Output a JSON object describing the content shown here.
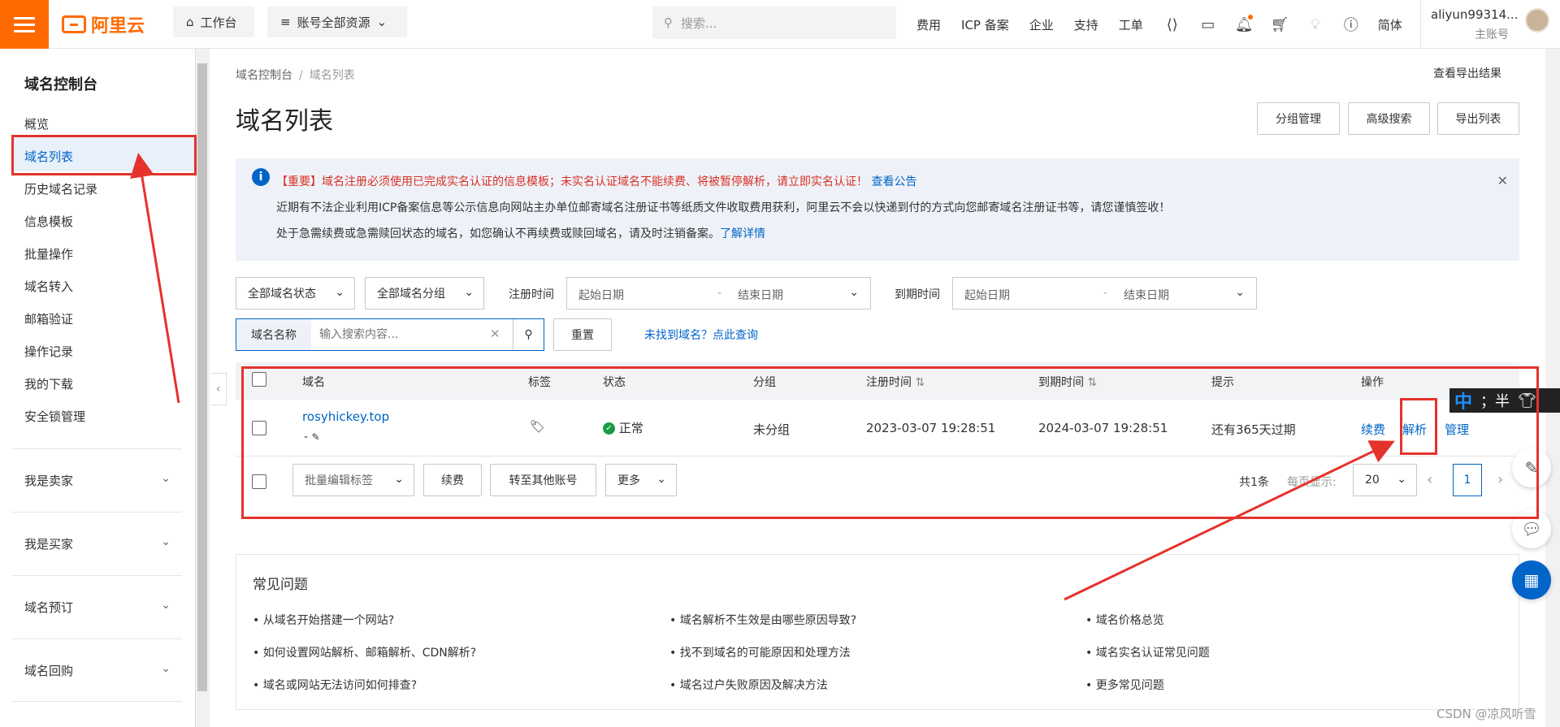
{
  "topbar": {
    "logo_text": "阿里云",
    "workbench": "工作台",
    "resources": "账号全部资源",
    "search_placeholder": "搜索...",
    "nav": [
      "费用",
      "ICP 备案",
      "企业",
      "支持",
      "工单"
    ],
    "lang": "简体",
    "user_name": "aliyun99314...",
    "user_role": "主账号"
  },
  "sidebar": {
    "title": "域名控制台",
    "items": [
      "概览",
      "域名列表",
      "历史域名记录",
      "信息模板",
      "批量操作",
      "域名转入",
      "邮箱验证",
      "操作记录",
      "我的下载",
      "安全锁管理"
    ],
    "groups": [
      "我是卖家",
      "我是买家",
      "域名预订",
      "域名回购"
    ]
  },
  "breadcrumb": {
    "root": "域名控制台",
    "current": "域名列表"
  },
  "export_result": "查看导出结果",
  "page_title": "域名列表",
  "actions": {
    "group": "分组管理",
    "advanced": "高级搜索",
    "export": "导出列表"
  },
  "notice": {
    "line1": "【重要】域名注册必须使用已完成实名认证的信息模板；未实名认证域名不能续费、将被暂停解析，请立即实名认证！",
    "line1_link": "查看公告",
    "line2": "近期有不法企业利用ICP备案信息等公示信息向网站主办单位邮寄域名注册证书等纸质文件收取费用获利，阿里云不会以快递到付的方式向您邮寄域名注册证书等，请您谨慎签收！",
    "line3": "处于急需续费或急需赎回状态的域名，如您确认不再续费或赎回域名，请及时注销备案。",
    "line3_link": "了解详情"
  },
  "filters": {
    "status": "全部域名状态",
    "group": "全部域名分组",
    "reg_label": "注册时间",
    "exp_label": "到期时间",
    "start": "起始日期",
    "end": "结束日期",
    "name_label": "域名名称",
    "search_placeholder": "输入搜索内容...",
    "reset": "重置",
    "not_found": "未找到域名？点此查询"
  },
  "table": {
    "headers": {
      "domain": "域名",
      "tag": "标签",
      "status": "状态",
      "group": "分组",
      "reg": "注册时间",
      "exp": "到期时间",
      "hint": "提示",
      "ops": "操作"
    },
    "rows": [
      {
        "domain": "rosyhickey.top",
        "sub": "-",
        "status": "正常",
        "group": "未分组",
        "reg": "2023-03-07 19:28:51",
        "exp": "2024-03-07 19:28:51",
        "hint": "还有365天过期",
        "op_renew": "续费",
        "op_dns": "解析",
        "op_manage": "管理"
      }
    ]
  },
  "bulk": {
    "edit_tags": "批量编辑标签",
    "renew": "续费",
    "transfer": "转至其他账号",
    "more": "更多",
    "total": "共1条",
    "per_page_label": "每页显示:",
    "per_page": "20",
    "page": "1"
  },
  "faq": {
    "title": "常见问题",
    "items": [
      [
        "• 从域名开始搭建一个网站?",
        "• 域名解析不生效是由哪些原因导致?",
        "• 域名价格总览"
      ],
      [
        "• 如何设置网站解析、邮箱解析、CDN解析?",
        "• 找不到域名的可能原因和处理方法",
        "• 域名实名认证常见问题"
      ],
      [
        "• 域名或网站无法访问如何排查?",
        "• 域名过户失败原因及解决方法",
        "• 更多常见问题"
      ]
    ]
  },
  "ime": {
    "zh": "中",
    "rest": "；半"
  },
  "watermark": "CSDN @凉风听雪",
  "colors": {
    "accent": "#ff6a00",
    "link": "#0064c8",
    "annotation": "#e5322d"
  }
}
